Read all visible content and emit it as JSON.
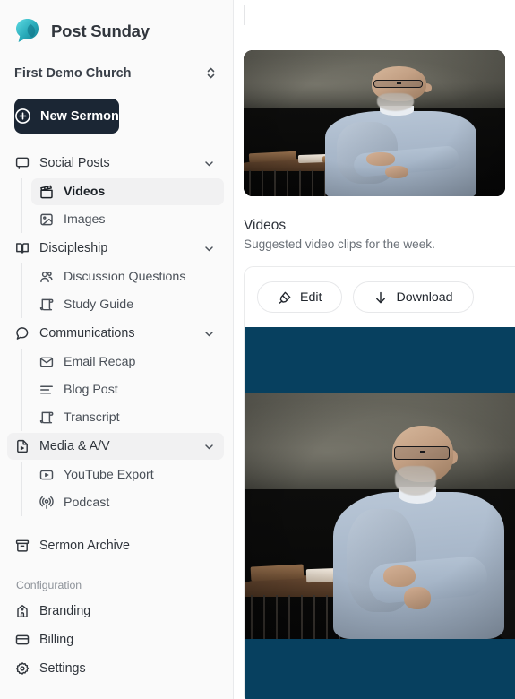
{
  "brand": {
    "name": "Post Sunday",
    "logo_icon": "speech-bubble-logo",
    "logo_color": "#2fb3bf"
  },
  "org_switcher": {
    "name": "First Demo Church",
    "icon": "chevrons-up-down-icon"
  },
  "primary_action": {
    "label": "New Sermon",
    "icon": "plus-circle-icon",
    "background": "#1b2634"
  },
  "sidebar": {
    "groups": [
      {
        "label": "Social Posts",
        "icon": "message-square-icon",
        "expanded": true,
        "active": false,
        "children": [
          {
            "label": "Videos",
            "icon": "clapperboard-icon",
            "active": true
          },
          {
            "label": "Images",
            "icon": "image-icon",
            "active": false
          }
        ]
      },
      {
        "label": "Discipleship",
        "icon": "book-open-icon",
        "expanded": true,
        "active": false,
        "children": [
          {
            "label": "Discussion Questions",
            "icon": "users-icon",
            "active": false
          },
          {
            "label": "Study Guide",
            "icon": "scroll-icon",
            "active": false
          }
        ]
      },
      {
        "label": "Communications",
        "icon": "message-circle-icon",
        "expanded": true,
        "active": false,
        "children": [
          {
            "label": "Email Recap",
            "icon": "mail-icon",
            "active": false
          },
          {
            "label": "Blog Post",
            "icon": "align-left-icon",
            "active": false
          },
          {
            "label": "Transcript",
            "icon": "scroll-icon",
            "active": false
          }
        ]
      },
      {
        "label": "Media & A/V",
        "icon": "file-play-icon",
        "expanded": true,
        "active": true,
        "children": [
          {
            "label": "YouTube Export",
            "icon": "video-play-icon",
            "active": false
          },
          {
            "label": "Podcast",
            "icon": "podcast-icon",
            "active": false
          }
        ]
      }
    ],
    "flat_items": [
      {
        "label": "Sermon Archive",
        "icon": "archive-icon"
      }
    ],
    "section_label": "Configuration",
    "config_items": [
      {
        "label": "Branding",
        "icon": "church-icon"
      },
      {
        "label": "Billing",
        "icon": "credit-card-icon"
      },
      {
        "label": "Settings",
        "icon": "gear-icon"
      }
    ]
  },
  "main": {
    "hero_thumbnail_alt": "sermon-speaker-thumbnail",
    "section_title": "Videos",
    "section_subtitle": "Suggested video clips for the week.",
    "card": {
      "actions": [
        {
          "label": "Edit",
          "icon": "highlighter-icon"
        },
        {
          "label": "Download",
          "icon": "arrow-down-icon"
        }
      ],
      "video_alt": "sermon-clip-video",
      "letterbox_color": "#07405f"
    }
  }
}
